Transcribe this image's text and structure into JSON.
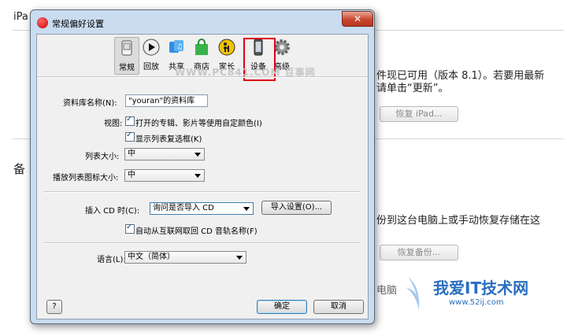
{
  "background": {
    "ipad_fragment": "iPa",
    "update_line1": "件现已可用（版本 8.1）。若要用最新",
    "update_line2": "请单击“更新”。",
    "restore_ipad_button": "恢复 iPad...",
    "backup_fragment": "备",
    "backup_line": "份到这台电脑上或手动恢复存储在这",
    "restore_backup_button": "恢复备份...",
    "computer_fragment": "电脑"
  },
  "dialog": {
    "title": "常规偏好设置",
    "close_glyph": "✕",
    "toolbar": [
      {
        "label": "常规",
        "icon": "general-icon"
      },
      {
        "label": "回放",
        "icon": "playback-icon"
      },
      {
        "label": "共享",
        "icon": "sharing-icon"
      },
      {
        "label": "商店",
        "icon": "store-icon"
      },
      {
        "label": "家长",
        "icon": "parental-icon"
      },
      {
        "label": "设备",
        "icon": "devices-icon"
      },
      {
        "label": "高级",
        "icon": "advanced-icon"
      }
    ],
    "library_name_label": "资料库名称(N):",
    "library_name_value": "\"youran\"的资料库",
    "views_label": "视图:",
    "custom_color_label": "打开的专辑、影片等使用自定颜色(I)",
    "show_checkbox_label": "显示列表复选框(K)",
    "list_size_label": "列表大小:",
    "list_size_value": "中",
    "playlist_icon_size_label": "播放列表图标大小:",
    "playlist_icon_size_value": "中",
    "insert_cd_label": "插入 CD 时(C):",
    "insert_cd_value": "询问是否导入 CD",
    "import_settings_button": "导入设置(O)...",
    "auto_cd_names_label": "自动从互联网取回 CD 音轨名称(F)",
    "language_label": "语言(L):",
    "language_value": "中文（简体）",
    "help_button": "?",
    "ok_button": "确定",
    "cancel_button": "取消"
  },
  "watermarks": {
    "pc841": "WWW.PC841.COM 百事网",
    "site_logo": "我爱IT技术网",
    "site_url": "www.52ij.com"
  },
  "colors": {
    "highlight_box": "#e0001a",
    "window_frame": "#c9dcf0",
    "logo_blue": "#2a6fbf"
  }
}
